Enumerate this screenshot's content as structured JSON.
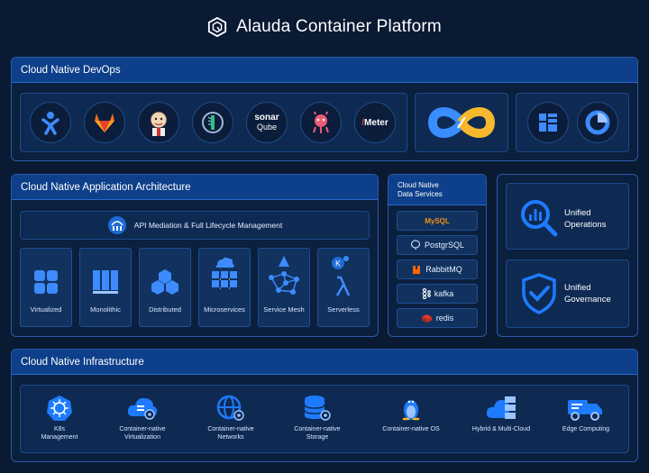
{
  "header": {
    "title": "Alauda Container Platform"
  },
  "devops": {
    "title": "Cloud Native DevOps",
    "tools": [
      {
        "icon": "jira-icon"
      },
      {
        "icon": "gitlab-icon"
      },
      {
        "icon": "jenkins-icon"
      },
      {
        "icon": "sonatype-icon"
      },
      {
        "icon": "sonarqube-icon",
        "line1": "sonar",
        "line2": "Qube"
      },
      {
        "icon": "harbor-icon"
      },
      {
        "icon": "jmeter-icon",
        "text": "Meter"
      }
    ]
  },
  "architecture": {
    "title": "Cloud Native Application Architecture",
    "api_label": "API Mediation & Full Lifecycle Management",
    "cards": [
      {
        "label": "Virtualized",
        "icon": "virtualized-icon"
      },
      {
        "label": "Monolithic",
        "icon": "monolithic-icon"
      },
      {
        "label": "Distributed",
        "icon": "distributed-icon"
      },
      {
        "label": "Microservices",
        "icon": "microservices-icon"
      },
      {
        "label": "Service Mesh",
        "icon": "service-mesh-icon"
      },
      {
        "label": "Serverless",
        "icon": "serverless-icon"
      }
    ]
  },
  "data_services": {
    "title_line1": "Cloud Native",
    "title_line2": "Data Services",
    "items": [
      {
        "label": "MySQL"
      },
      {
        "label": "PostgrSQL"
      },
      {
        "label": "RabbitMQ"
      },
      {
        "label": "kafka"
      },
      {
        "label": "redis"
      }
    ]
  },
  "unified": {
    "operations_line1": "Unified",
    "operations_line2": "Operations",
    "governance_line1": "Unified",
    "governance_line2": "Governance"
  },
  "infrastructure": {
    "title": "Cloud Native Infrastructure",
    "items": [
      {
        "line1": "K8s",
        "line2": "Management"
      },
      {
        "line1": "Container-native",
        "line2": "Virtualization"
      },
      {
        "line1": "Container-native",
        "line2": "Networks"
      },
      {
        "line1": "Container-native",
        "line2": "Storage"
      },
      {
        "line1": "Container-native OS",
        "line2": ""
      },
      {
        "line1": "Hybrid & Multi-Cloud",
        "line2": ""
      },
      {
        "line1": "Edge Computing",
        "line2": ""
      }
    ]
  },
  "colors": {
    "accent": "#1e7bff",
    "panel": "#0e2a52",
    "header_bar": "#0e3f8a"
  }
}
